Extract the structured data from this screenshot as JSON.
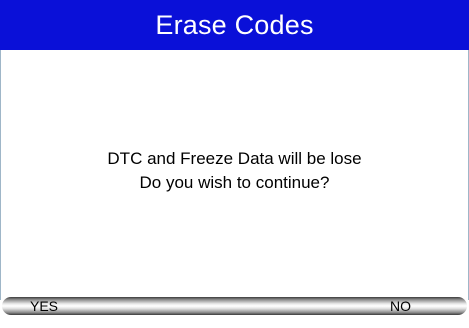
{
  "screen": {
    "title": "Erase Codes",
    "title_bar_color": "#0a10d8"
  },
  "message": {
    "line1": "DTC and Freeze Data will be lose",
    "line2": "Do you wish to continue?"
  },
  "buttons": {
    "yes_label": "YES",
    "no_label": "NO"
  }
}
